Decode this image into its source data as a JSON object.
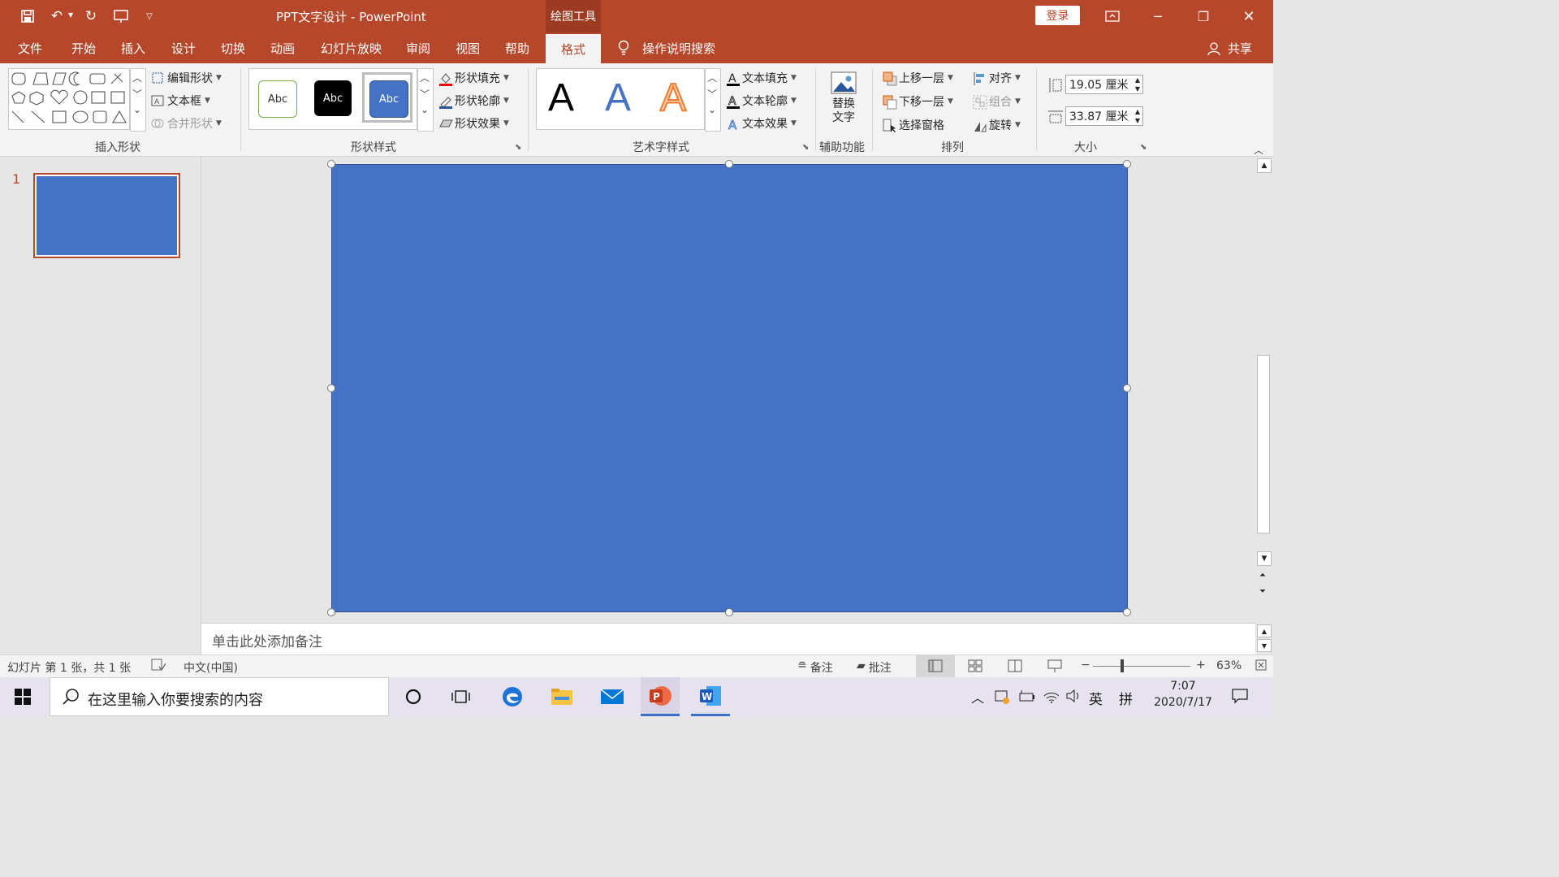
{
  "window": {
    "title": "PPT文字设计 - PowerPoint",
    "context_tab_group": "绘图工具",
    "login_label": "登录",
    "share_label": "共享"
  },
  "tabs": [
    {
      "label": "文件"
    },
    {
      "label": "开始"
    },
    {
      "label": "插入"
    },
    {
      "label": "设计"
    },
    {
      "label": "切换"
    },
    {
      "label": "动画"
    },
    {
      "label": "幻灯片放映"
    },
    {
      "label": "审阅"
    },
    {
      "label": "视图"
    },
    {
      "label": "帮助"
    },
    {
      "label": "格式",
      "active": true
    }
  ],
  "search_hint": "操作说明搜索",
  "ribbon": {
    "insert_shapes": {
      "label": "插入形状",
      "edit_shape": "编辑形状",
      "text_box": "文本框",
      "merge_shapes": "合并形状"
    },
    "shape_styles": {
      "label": "形状样式",
      "samples": [
        "Abc",
        "Abc",
        "Abc"
      ],
      "fill": "形状填充",
      "outline": "形状轮廓",
      "effects": "形状效果"
    },
    "wordart": {
      "label": "艺术字样式",
      "samples": [
        "A",
        "A",
        "A"
      ],
      "text_fill": "文本填充",
      "text_outline": "文本轮廓",
      "text_effects": "文本效果"
    },
    "accessibility": {
      "label": "辅助功能",
      "alt_text_line1": "替换",
      "alt_text_line2": "文字"
    },
    "arrange": {
      "label": "排列",
      "bring_forward": "上移一层",
      "send_backward": "下移一层",
      "selection_pane": "选择窗格",
      "align": "对齐",
      "group": "组合",
      "rotate": "旋转"
    },
    "size": {
      "label": "大小",
      "height": "19.05 厘米",
      "width": "33.87 厘米"
    }
  },
  "thumbnails": [
    {
      "number": "1"
    }
  ],
  "notes_placeholder": "单击此处添加备注",
  "status": {
    "slide_info": "幻灯片 第 1 张，共 1 张",
    "language": "中文(中国)",
    "notes": "备注",
    "comments": "批注",
    "zoom": "63%"
  },
  "taskbar": {
    "search_placeholder": "在这里输入你要搜索的内容",
    "ime_lang": "英",
    "ime_mode": "拼",
    "time": "7:07",
    "date": "2020/7/17"
  },
  "colors": {
    "accent": "#b7472a",
    "shape_fill": "#4472c4"
  }
}
